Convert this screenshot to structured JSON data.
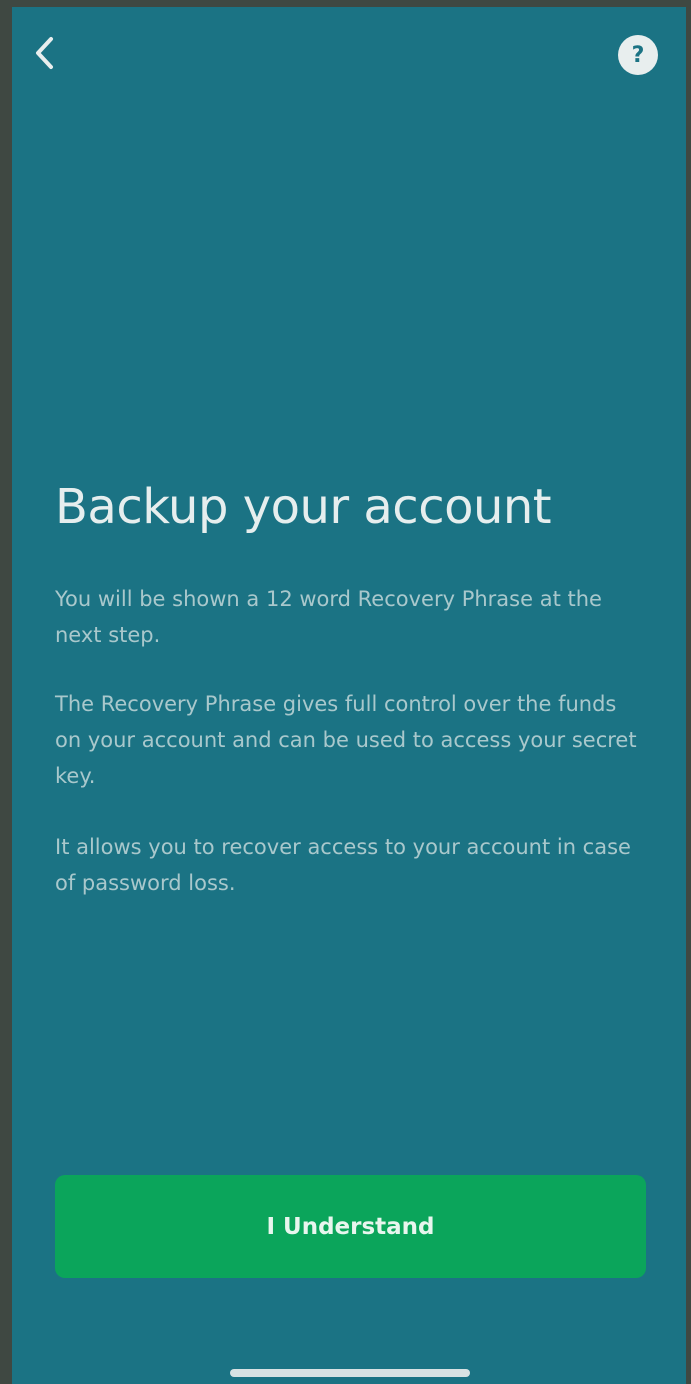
{
  "header": {
    "back_icon": "chevron-left-icon",
    "help_icon": "help-circle-icon",
    "help_glyph": "?"
  },
  "main": {
    "title": "Backup your account",
    "paragraphs": [
      "You will be shown a 12 word Recovery Phrase at the next step.",
      "The Recovery Phrase gives full control over the funds on your account and can be used to access your secret key.",
      "It allows you to recover access to your account in case of password loss."
    ]
  },
  "footer": {
    "confirm_label": "I Understand"
  },
  "colors": {
    "background": "#1b7384",
    "primary_button": "#0ba55b",
    "title_text": "#e6eeee",
    "body_text": "#a9c8cc"
  }
}
